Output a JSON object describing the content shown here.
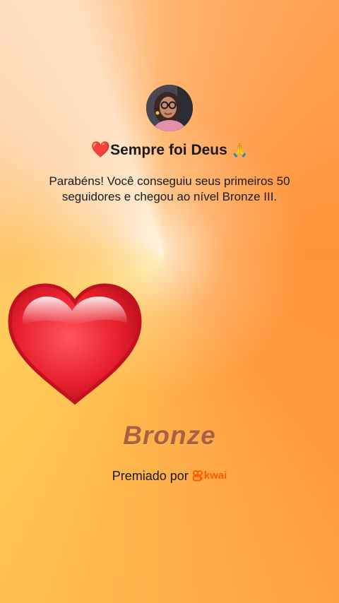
{
  "profile": {
    "avatar_icon": "user-photo-avatar-icon"
  },
  "title": {
    "prefix_emoji": "❤️",
    "text": "Sempre foi Deus",
    "suffix_emoji": "🙏"
  },
  "message": "Parabéns! Você conseguiu seus primeiros 50 seguidores e chegou ao nível Bronze III.",
  "badge": {
    "icon": "heart-icon",
    "level_name": "Bronze"
  },
  "footer": {
    "awarded_by_label": "Premiado por",
    "brand_icon": "kwai-logo-icon",
    "brand_name": "kwai"
  },
  "colors": {
    "brand": "#ff5a00",
    "level_text": "#a86040",
    "heart": "#e8202c"
  }
}
